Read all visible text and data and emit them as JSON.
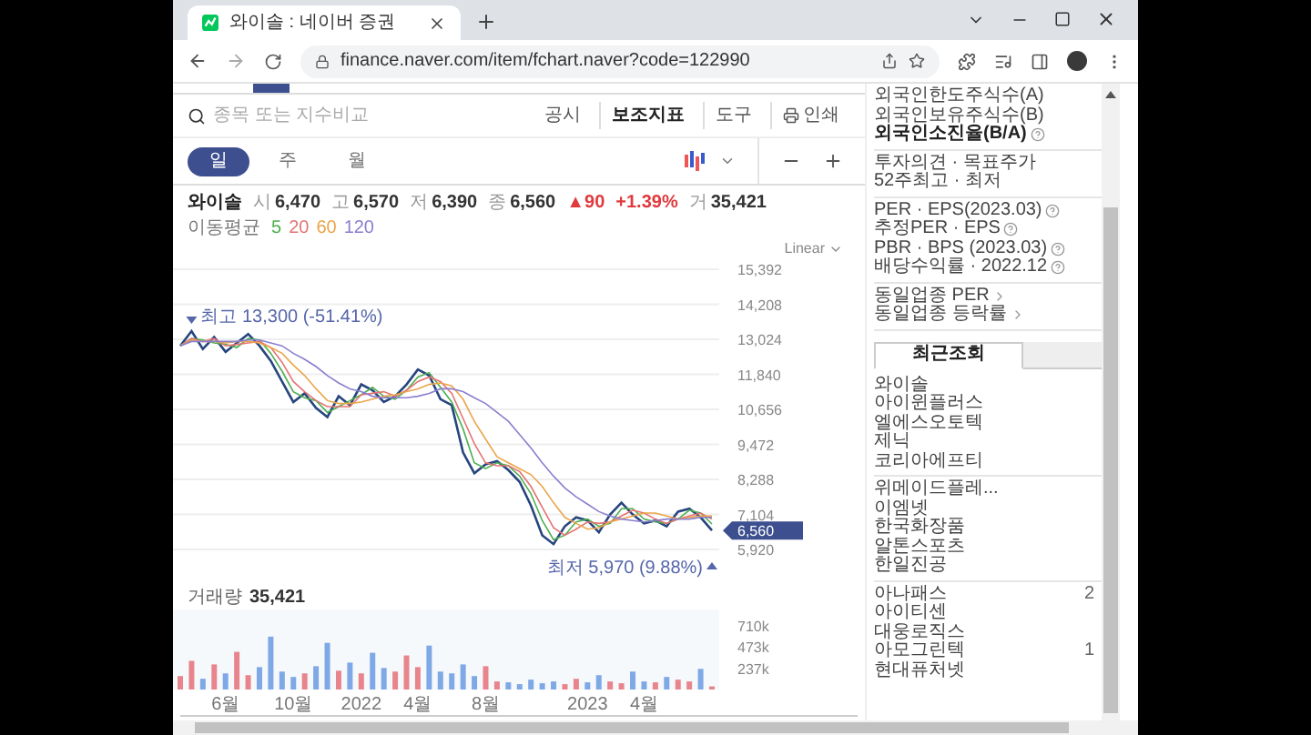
{
  "browser": {
    "tab": {
      "title": "와이솔 : 네이버 증권"
    },
    "address": "finance.naver.com/item/fchart.naver?code=122990"
  },
  "toolbar": {
    "search": {
      "placeholder": "종목 또는 지수비교"
    },
    "links": [
      {
        "label": "공시",
        "emphasized": false,
        "kind": "text"
      },
      {
        "label": "보조지표",
        "emphasized": true,
        "kind": "text"
      },
      {
        "label": "도구",
        "emphasized": false,
        "kind": "text"
      },
      {
        "label": "인쇄",
        "emphasized": false,
        "kind": "print"
      }
    ]
  },
  "periods": [
    {
      "label": "일",
      "selected": true
    },
    {
      "label": "주",
      "selected": false
    },
    {
      "label": "월",
      "selected": false
    }
  ],
  "quote": {
    "name": "와이솔",
    "items": [
      {
        "kind": "field",
        "label": "시",
        "value": "6,470"
      },
      {
        "kind": "field",
        "label": "고",
        "value": "6,570"
      },
      {
        "kind": "field",
        "label": "저",
        "value": "6,390"
      },
      {
        "kind": "field",
        "label": "종",
        "value": "6,560"
      },
      {
        "kind": "change",
        "value": "▲90"
      },
      {
        "kind": "change",
        "value": "+1.39%"
      },
      {
        "kind": "field",
        "label": "거",
        "value": "35,421"
      }
    ]
  },
  "moving_averages": {
    "label": "이동평균"
  },
  "scale": {
    "label": "Linear"
  },
  "price_chart": {
    "current_price": "6,560",
    "chart_data": {
      "type": "line",
      "grid": true,
      "series": [
        {
          "color": "#27457e",
          "values": [
            12800,
            13300,
            12700,
            13100,
            12600,
            12900,
            13200,
            12800,
            12300,
            11600,
            10900,
            11200,
            10700,
            10400,
            11100,
            10800,
            11500,
            11300,
            10900,
            11100,
            11500,
            12000,
            11800,
            11000,
            10800,
            9200,
            8500,
            8800,
            8900,
            8600,
            8200,
            7400,
            6400,
            6100,
            6700,
            7000,
            6900,
            6500,
            7100,
            7500,
            7100,
            6800,
            6900,
            6700,
            7200,
            7300,
            7000,
            6560
          ]
        },
        {
          "name": "5",
          "color": "#4caf50",
          "values": [
            12800,
            13050,
            13000,
            12900,
            12850,
            12750,
            13050,
            13000,
            12550,
            11950,
            11250,
            11050,
            10950,
            10550,
            10750,
            10950,
            11150,
            11400,
            11100,
            11000,
            11300,
            11750,
            11900,
            11400,
            10900,
            10000,
            8850,
            8650,
            8850,
            8750,
            8400,
            7800,
            6900,
            6250,
            6400,
            6850,
            6950,
            6700,
            6800,
            7300,
            7300,
            6950,
            6850,
            6800,
            6950,
            7250,
            7150,
            6780
          ]
        },
        {
          "name": "20",
          "color": "#e57373",
          "values": [
            12800,
            13050,
            12950,
            13050,
            12800,
            12850,
            12900,
            12950,
            12750,
            12250,
            11600,
            11250,
            10950,
            10750,
            10750,
            10750,
            11150,
            11200,
            11250,
            11100,
            11300,
            11600,
            11750,
            11600,
            11200,
            10350,
            9500,
            8850,
            8750,
            8750,
            8550,
            8050,
            7350,
            6650,
            6400,
            6600,
            6850,
            6800,
            6850,
            7050,
            7250,
            7150,
            6950,
            6800,
            6950,
            7050,
            7150,
            6950
          ]
        },
        {
          "name": "60",
          "color": "#eba54a",
          "values": [
            12800,
            13000,
            12950,
            12950,
            12900,
            12950,
            12950,
            12900,
            12750,
            12550,
            12150,
            11800,
            11350,
            10950,
            10850,
            10850,
            10900,
            11000,
            11100,
            11150,
            11250,
            11350,
            11500,
            11550,
            11450,
            11000,
            10250,
            9650,
            9050,
            8850,
            8650,
            8450,
            8050,
            7500,
            7000,
            6800,
            6600,
            6650,
            6850,
            6950,
            7050,
            7150,
            7150,
            7050,
            6950,
            7000,
            7050,
            7050
          ]
        },
        {
          "name": "120",
          "color": "#8a7fd0",
          "values": [
            12800,
            12950,
            12950,
            12950,
            12950,
            12950,
            13000,
            13000,
            12900,
            12800,
            12550,
            12350,
            12100,
            11800,
            11550,
            11350,
            11250,
            11100,
            11050,
            11050,
            11050,
            11100,
            11200,
            11350,
            11350,
            11250,
            11050,
            10850,
            10550,
            10250,
            9800,
            9350,
            8850,
            8400,
            8000,
            7700,
            7450,
            7200,
            7050,
            6950,
            6900,
            6850,
            6900,
            6950,
            6950,
            6950,
            7000,
            7000
          ]
        }
      ],
      "ylim": [
        5920,
        15392
      ],
      "yticks": [
        {
          "value": 15392,
          "label": "15,392"
        },
        {
          "value": 14208,
          "label": "14,208"
        },
        {
          "value": 13024,
          "label": "13,024"
        },
        {
          "value": 11840,
          "label": "11,840"
        },
        {
          "value": 10656,
          "label": "10,656"
        },
        {
          "value": 9472,
          "label": "9,472"
        },
        {
          "value": 8288,
          "label": "8,288"
        },
        {
          "value": 7104,
          "label": "7,104"
        },
        {
          "value": 5920,
          "label": "5,920"
        }
      ],
      "annotations": [
        "최고 13,300 (-51.41%)",
        "최저 5,970 (9.88%)"
      ]
    }
  },
  "volume_chart": {
    "value": "35,421",
    "chart_data": {
      "type": "bar",
      "categories": [
        null,
        null,
        null,
        null,
        "6월",
        null,
        null,
        null,
        null,
        null,
        "10월",
        null,
        null,
        null,
        null,
        null,
        "2022",
        null,
        null,
        null,
        null,
        "4월",
        null,
        null,
        null,
        null,
        null,
        "8월",
        null,
        null,
        null,
        null,
        null,
        null,
        null,
        null,
        "2023",
        null,
        null,
        null,
        null,
        "4월",
        null,
        null,
        null,
        null,
        null,
        null
      ],
      "series": [
        {
          "name": "거래량",
          "color": "#e8858c",
          "values": [
            150,
            320,
            null,
            280,
            null,
            420,
            160,
            null,
            null,
            null,
            null,
            180,
            null,
            null,
            210,
            null,
            180,
            null,
            null,
            200,
            380,
            250,
            null,
            null,
            null,
            null,
            null,
            260,
            90,
            null,
            null,
            null,
            null,
            null,
            60,
            120,
            null,
            null,
            90,
            70,
            null,
            null,
            80,
            null,
            110,
            90,
            null,
            35
          ]
        },
        {
          "color": "#7fa8e6",
          "values": [
            null,
            null,
            120,
            null,
            180,
            null,
            null,
            250,
            590,
            200,
            140,
            null,
            260,
            520,
            null,
            300,
            null,
            410,
            240,
            null,
            null,
            null,
            490,
            200,
            180,
            280,
            150,
            null,
            null,
            80,
            60,
            110,
            70,
            90,
            null,
            null,
            80,
            160,
            null,
            null,
            200,
            90,
            null,
            140,
            null,
            null,
            230,
            null
          ]
        }
      ],
      "ylim": [
        0,
        852
      ],
      "yticks": [
        {
          "value": 710,
          "label": "710k"
        },
        {
          "value": 473,
          "label": "473k"
        },
        {
          "value": 237,
          "label": "237k"
        }
      ]
    }
  },
  "side_panel": {
    "groups": [
      {
        "items": [
          {
            "label": "외국인한도주식수(A)",
            "bold": false,
            "help": false,
            "link": false
          },
          {
            "label": "외국인보유주식수(B)",
            "bold": false,
            "help": false,
            "link": false
          },
          {
            "label": "외국인소진율(B/A)",
            "bold": true,
            "help": true,
            "link": false
          }
        ]
      },
      {
        "items": [
          {
            "label": "투자의견 · 목표주가",
            "bold": false,
            "help": false,
            "link": false
          },
          {
            "label": "52주최고 · 최저",
            "bold": false,
            "help": false,
            "link": false
          }
        ]
      },
      {
        "items": [
          {
            "label": "PER · EPS(2023.03)",
            "bold": false,
            "help": true,
            "link": false
          },
          {
            "label": "추정PER · EPS",
            "bold": false,
            "help": true,
            "link": false
          },
          {
            "label": "PBR · BPS (2023.03)",
            "bold": false,
            "help": true,
            "link": false
          },
          {
            "label": "배당수익률 · 2022.12",
            "bold": false,
            "help": true,
            "link": false
          }
        ]
      },
      {
        "items": [
          {
            "label": "동일업종 PER",
            "bold": false,
            "help": false,
            "link": true
          },
          {
            "label": "동일업종 등락률",
            "bold": false,
            "help": false,
            "link": true
          }
        ]
      }
    ]
  },
  "recent": {
    "tabs": [
      {
        "label": "최근조회",
        "selected": true
      }
    ],
    "groups": [
      [
        {
          "name": "와이솔"
        },
        {
          "name": "아이윈플러스"
        },
        {
          "name": "엘에스오토텍"
        },
        {
          "name": "제닉"
        },
        {
          "name": "코리아에프티"
        }
      ],
      [
        {
          "name": "위메이드플레..."
        },
        {
          "name": "이엠넷"
        },
        {
          "name": "한국화장품"
        },
        {
          "name": "알톤스포츠"
        },
        {
          "name": "한일진공"
        }
      ],
      [
        {
          "name": "아나패스",
          "count": "2"
        },
        {
          "name": "아이티센"
        },
        {
          "name": "대웅로직스"
        },
        {
          "name": "아모그린텍",
          "count": "1"
        },
        {
          "name": "현대퓨처넷"
        }
      ]
    ]
  }
}
